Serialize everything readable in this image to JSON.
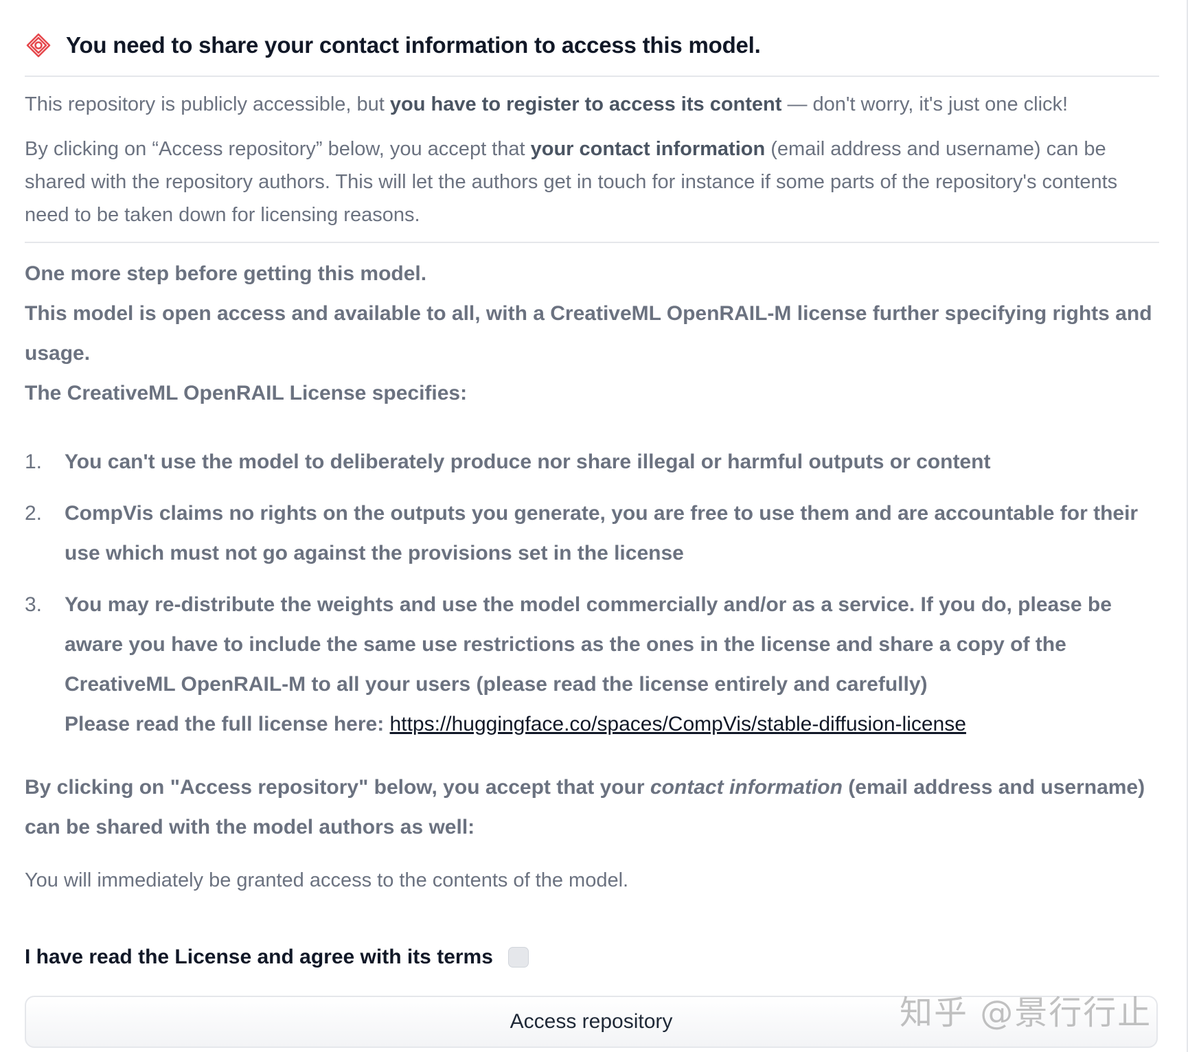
{
  "colors": {
    "warning_icon": "#e5484d",
    "text_dark": "#111827",
    "text_gray": "#6b7280",
    "divider": "#e5e7eb"
  },
  "header": {
    "icon": "gated-warning-icon",
    "title": "You need to share your contact information to access this model."
  },
  "intro": {
    "p1_before": "This repository is publicly accessible, but ",
    "p1_bold": "you have to register to access its content",
    "p1_after": " — don't worry, it's just one click!",
    "p2_before": "By clicking on “Access repository” below, you accept that ",
    "p2_bold": "your contact information",
    "p2_after": " (email address and username) can be shared with the repository authors. This will let the authors get in touch for instance if some parts of the repository's contents need to be taken down for licensing reasons."
  },
  "prompt": {
    "line1": "One more step before getting this model.",
    "line2": "This model is open access and available to all, with a CreativeML OpenRAIL-M license further specifying rights and usage.",
    "line3": "The CreativeML OpenRAIL License specifies:",
    "items": [
      {
        "num": "1.",
        "text": "You can't use the model to deliberately produce nor share illegal or harmful outputs or content"
      },
      {
        "num": "2.",
        "text": "CompVis claims no rights on the outputs you generate, you are free to use them and are accountable for their use which must not go against the provisions set in the license"
      },
      {
        "num": "3.",
        "text": "You may re-distribute the weights and use the model commercially and/or as a service. If you do, please be aware you have to include the same use restrictions as the ones in the license and share a copy of the CreativeML OpenRAIL-M to all your users (please read the license entirely and carefully)",
        "link_prefix": "Please read the full license here: ",
        "link_text": "https://huggingface.co/spaces/CompVis/stable-diffusion-license"
      }
    ],
    "closing_before": "By clicking on \"Access repository\" below, you accept that your ",
    "closing_italic": "contact information",
    "closing_after": " (email address and username) can be shared with the model authors as well:"
  },
  "granted_text": "You will immediately be granted access to the contents of the model.",
  "agree": {
    "label": "I have read the License and agree with its terms",
    "checked": false
  },
  "access_button": "Access repository",
  "watermark": "知乎 @景行行止"
}
